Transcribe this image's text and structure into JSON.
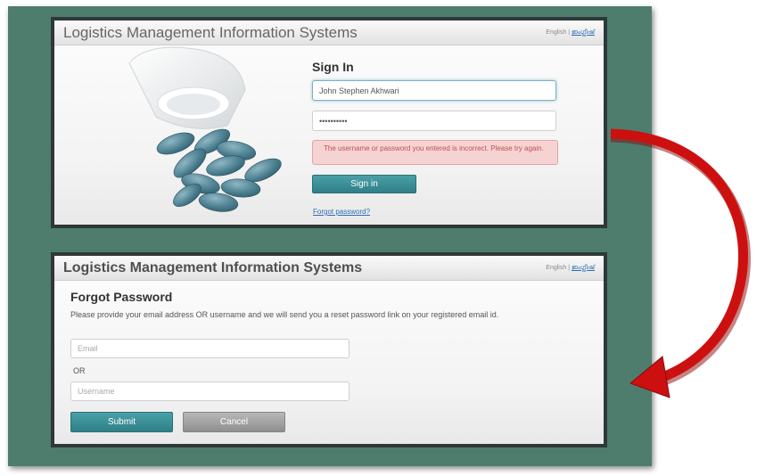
{
  "app": {
    "title": "Logistics Management Information Systems",
    "language_current": "English |",
    "language_alt": "ഇംഗ്ലീഷ്"
  },
  "signin": {
    "heading": "Sign In",
    "username_value": "John Stephen Akhwari",
    "password_value": "••••••••••",
    "error_message": "The username or password you entered is incorrect. Please try again.",
    "submit_label": "Sign in",
    "forgot_link": "Forgot password?"
  },
  "forgot": {
    "heading": "Forgot Password",
    "description": "Please provide your email address OR username and we will send you a reset password link on your registered email id.",
    "email_placeholder": "Email",
    "or_label": "OR",
    "username_placeholder": "Username",
    "submit_label": "Submit",
    "cancel_label": "Cancel"
  },
  "icons": {
    "pills_image": "pill-bottle-image",
    "flow_arrow": "curved-arrow-icon"
  },
  "colors": {
    "frame_bg": "#4e7d6e",
    "accent_teal": "#3a8f97",
    "error_bg": "#f6d3d3",
    "arrow_red": "#cc1010"
  }
}
